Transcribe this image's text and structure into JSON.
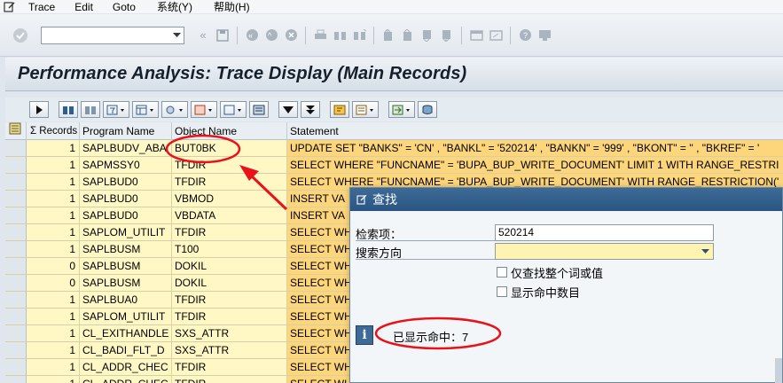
{
  "menu": {
    "items": [
      "Trace",
      "Edit",
      "Goto",
      "系统(Y)",
      "帮助(H)"
    ]
  },
  "toolbar": {
    "command_value": ""
  },
  "title": "Performance Analysis: Trace Display (Main Records)",
  "table": {
    "headers": [
      "Σ Records",
      "Program Name",
      "Object Name",
      "Statement"
    ],
    "rows": [
      {
        "records": "1",
        "program": "SAPLBUDV_ABA",
        "object": "BUT0BK",
        "statement": "UPDATE  SET \"BANKS\" = 'CN' , \"BANKL\" = '520214' , \"BANKN\" = '999' , \"BKONT\" = '' , \"BKREF\" = '"
      },
      {
        "records": "1",
        "program": "SAPMSSY0",
        "object": "TFDIR",
        "statement": "SELECT  WHERE \"FUNCNAME\" = 'BUPA_BUP_WRITE_DOCUMENT'  LIMIT 1  WITH RANGE_RESTRI"
      },
      {
        "records": "1",
        "program": "SAPLBUD0",
        "object": "TFDIR",
        "statement": "SELECT  WHERE \"FUNCNAME\" = 'BUPA_BUP_WRITE_DOCUMENT'   WITH RANGE_RESTRICTION('"
      },
      {
        "records": "1",
        "program": "SAPLBUD0",
        "object": "VBMOD",
        "statement": "INSERT  VA"
      },
      {
        "records": "1",
        "program": "SAPLBUD0",
        "object": "VBDATA",
        "statement": "INSERT  VA"
      },
      {
        "records": "1",
        "program": "SAPLOM_UTILIT",
        "object": "TFDIR",
        "statement": "SELECT  WH"
      },
      {
        "records": "1",
        "program": "SAPLBUSM",
        "object": "T100",
        "statement": "SELECT  WH"
      },
      {
        "records": "0",
        "program": "SAPLBUSM",
        "object": "DOKIL",
        "statement": "SELECT  WH"
      },
      {
        "records": "0",
        "program": "SAPLBUSM",
        "object": "DOKIL",
        "statement": "SELECT  WH"
      },
      {
        "records": "1",
        "program": "SAPLBUA0",
        "object": "TFDIR",
        "statement": "SELECT  WH"
      },
      {
        "records": "1",
        "program": "SAPLOM_UTILIT",
        "object": "TFDIR",
        "statement": "SELECT  WH"
      },
      {
        "records": "1",
        "program": "CL_EXITHANDLE",
        "object": "SXS_ATTR",
        "statement": "SELECT  WH"
      },
      {
        "records": "1",
        "program": "CL_BADI_FLT_D",
        "object": "SXS_ATTR",
        "statement": "SELECT  WH"
      },
      {
        "records": "1",
        "program": "CL_ADDR_CHEC",
        "object": "TFDIR",
        "statement": "SELECT  WH"
      },
      {
        "records": "1",
        "program": "CL_ADDR_CHEC",
        "object": "TFDIR",
        "statement": "SELECT  WH"
      }
    ]
  },
  "dialog": {
    "title": "查找",
    "search_label": "检索项：",
    "search_value": "520214",
    "direction_label": "搜索方向",
    "direction_value": "",
    "check_whole_word": "仅查找整个词或值",
    "check_show_count": "显示命中数目",
    "info_text": "已显示命中：7"
  },
  "colors": {
    "row_bg": "#fff8c4",
    "statement_bg": "#fdd57a",
    "annotation": "#e8121a",
    "dialog_title": "#2a5582"
  }
}
